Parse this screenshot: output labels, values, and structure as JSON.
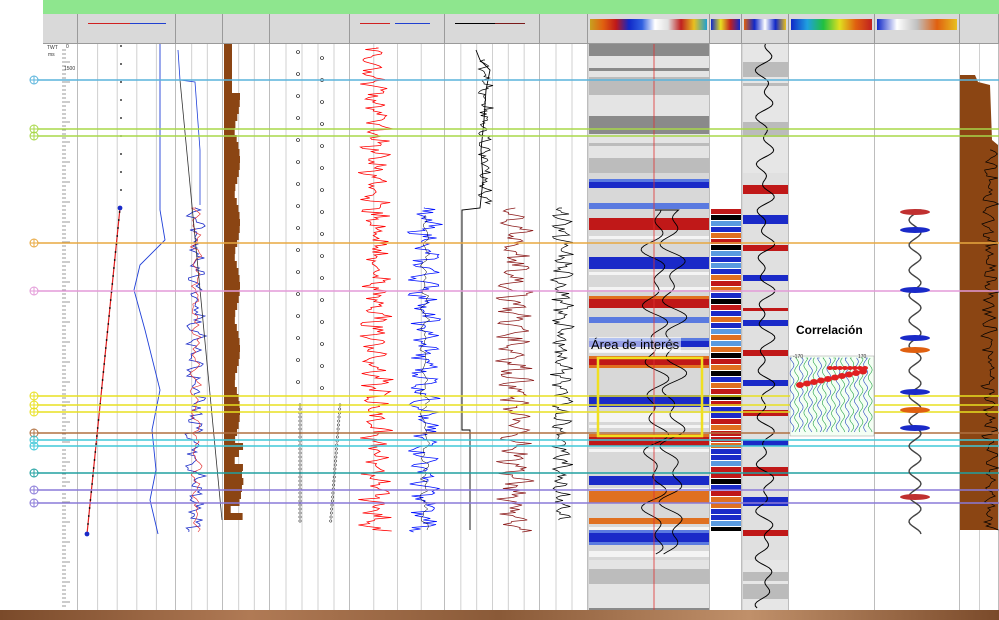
{
  "annotations": {
    "area_label": "Área de interés",
    "correlation_label": "Correlación",
    "corr_scale_left": "-170",
    "corr_scale_right": "170"
  },
  "depth_ruler": {
    "unit_line1": "TWT",
    "unit_line2": "ms",
    "first_tick": "0",
    "second_tick": "1500"
  },
  "colors": {
    "top_bar": "#8ee68e",
    "header_bg": "#d9d9d9",
    "marker_blue": "#5ab4dc",
    "marker_green": "#a8d84a",
    "marker_orange": "#e8a840",
    "marker_pink": "#e39ad8",
    "marker_yellow": "#e8e020",
    "marker_brown": "#b07040",
    "marker_cyan": "#40c8d8",
    "marker_teal": "#20a0a0",
    "marker_purple": "#8a7ad8",
    "log_red": "#ff0000",
    "log_blue": "#0000ff",
    "log_dark_red": "#8b1a1a",
    "log_brown": "#8b4513",
    "highlight_box": "#f0e020"
  },
  "icons": [
    "well-top-marker-icon"
  ]
}
